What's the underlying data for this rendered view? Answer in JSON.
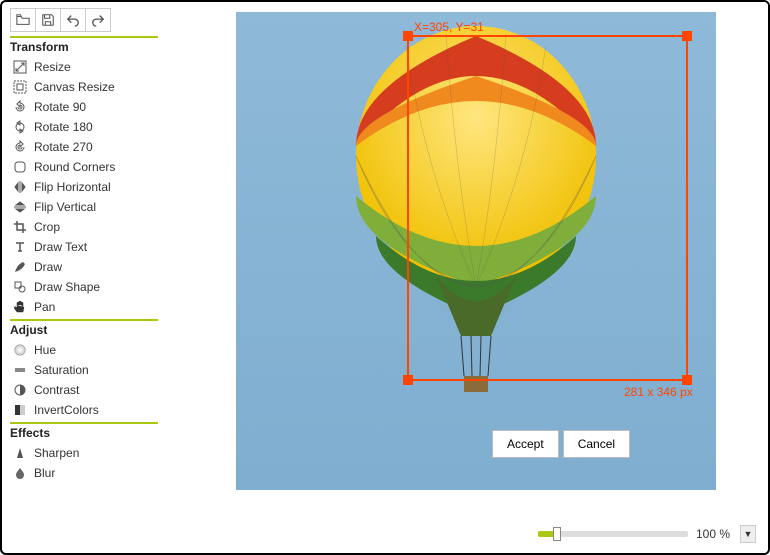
{
  "toolbar": {
    "open": "Open",
    "save": "Save",
    "undo": "Undo",
    "redo": "Redo"
  },
  "sections": {
    "transform": {
      "title": "Transform",
      "items": [
        {
          "icon": "resize",
          "label": "Resize"
        },
        {
          "icon": "canvas-resize",
          "label": "Canvas Resize"
        },
        {
          "icon": "rotate90",
          "label": "Rotate 90"
        },
        {
          "icon": "rotate180",
          "label": "Rotate 180"
        },
        {
          "icon": "rotate270",
          "label": "Rotate 270"
        },
        {
          "icon": "round-corners",
          "label": "Round Corners"
        },
        {
          "icon": "flip-h",
          "label": "Flip Horizontal"
        },
        {
          "icon": "flip-v",
          "label": "Flip Vertical"
        },
        {
          "icon": "crop",
          "label": "Crop"
        },
        {
          "icon": "text",
          "label": "Draw Text"
        },
        {
          "icon": "draw",
          "label": "Draw"
        },
        {
          "icon": "shape",
          "label": "Draw Shape"
        },
        {
          "icon": "pan",
          "label": "Pan"
        }
      ]
    },
    "adjust": {
      "title": "Adjust",
      "items": [
        {
          "icon": "hue",
          "label": "Hue"
        },
        {
          "icon": "saturation",
          "label": "Saturation"
        },
        {
          "icon": "contrast",
          "label": "Contrast"
        },
        {
          "icon": "invert",
          "label": "InvertColors"
        }
      ]
    },
    "effects": {
      "title": "Effects",
      "items": [
        {
          "icon": "sharpen",
          "label": "Sharpen"
        },
        {
          "icon": "blur",
          "label": "Blur"
        }
      ]
    }
  },
  "crop": {
    "coord": "X=305, Y=31",
    "dim": "281 x 346 px",
    "accept": "Accept",
    "cancel": "Cancel"
  },
  "zoom": {
    "value": "100 %"
  }
}
